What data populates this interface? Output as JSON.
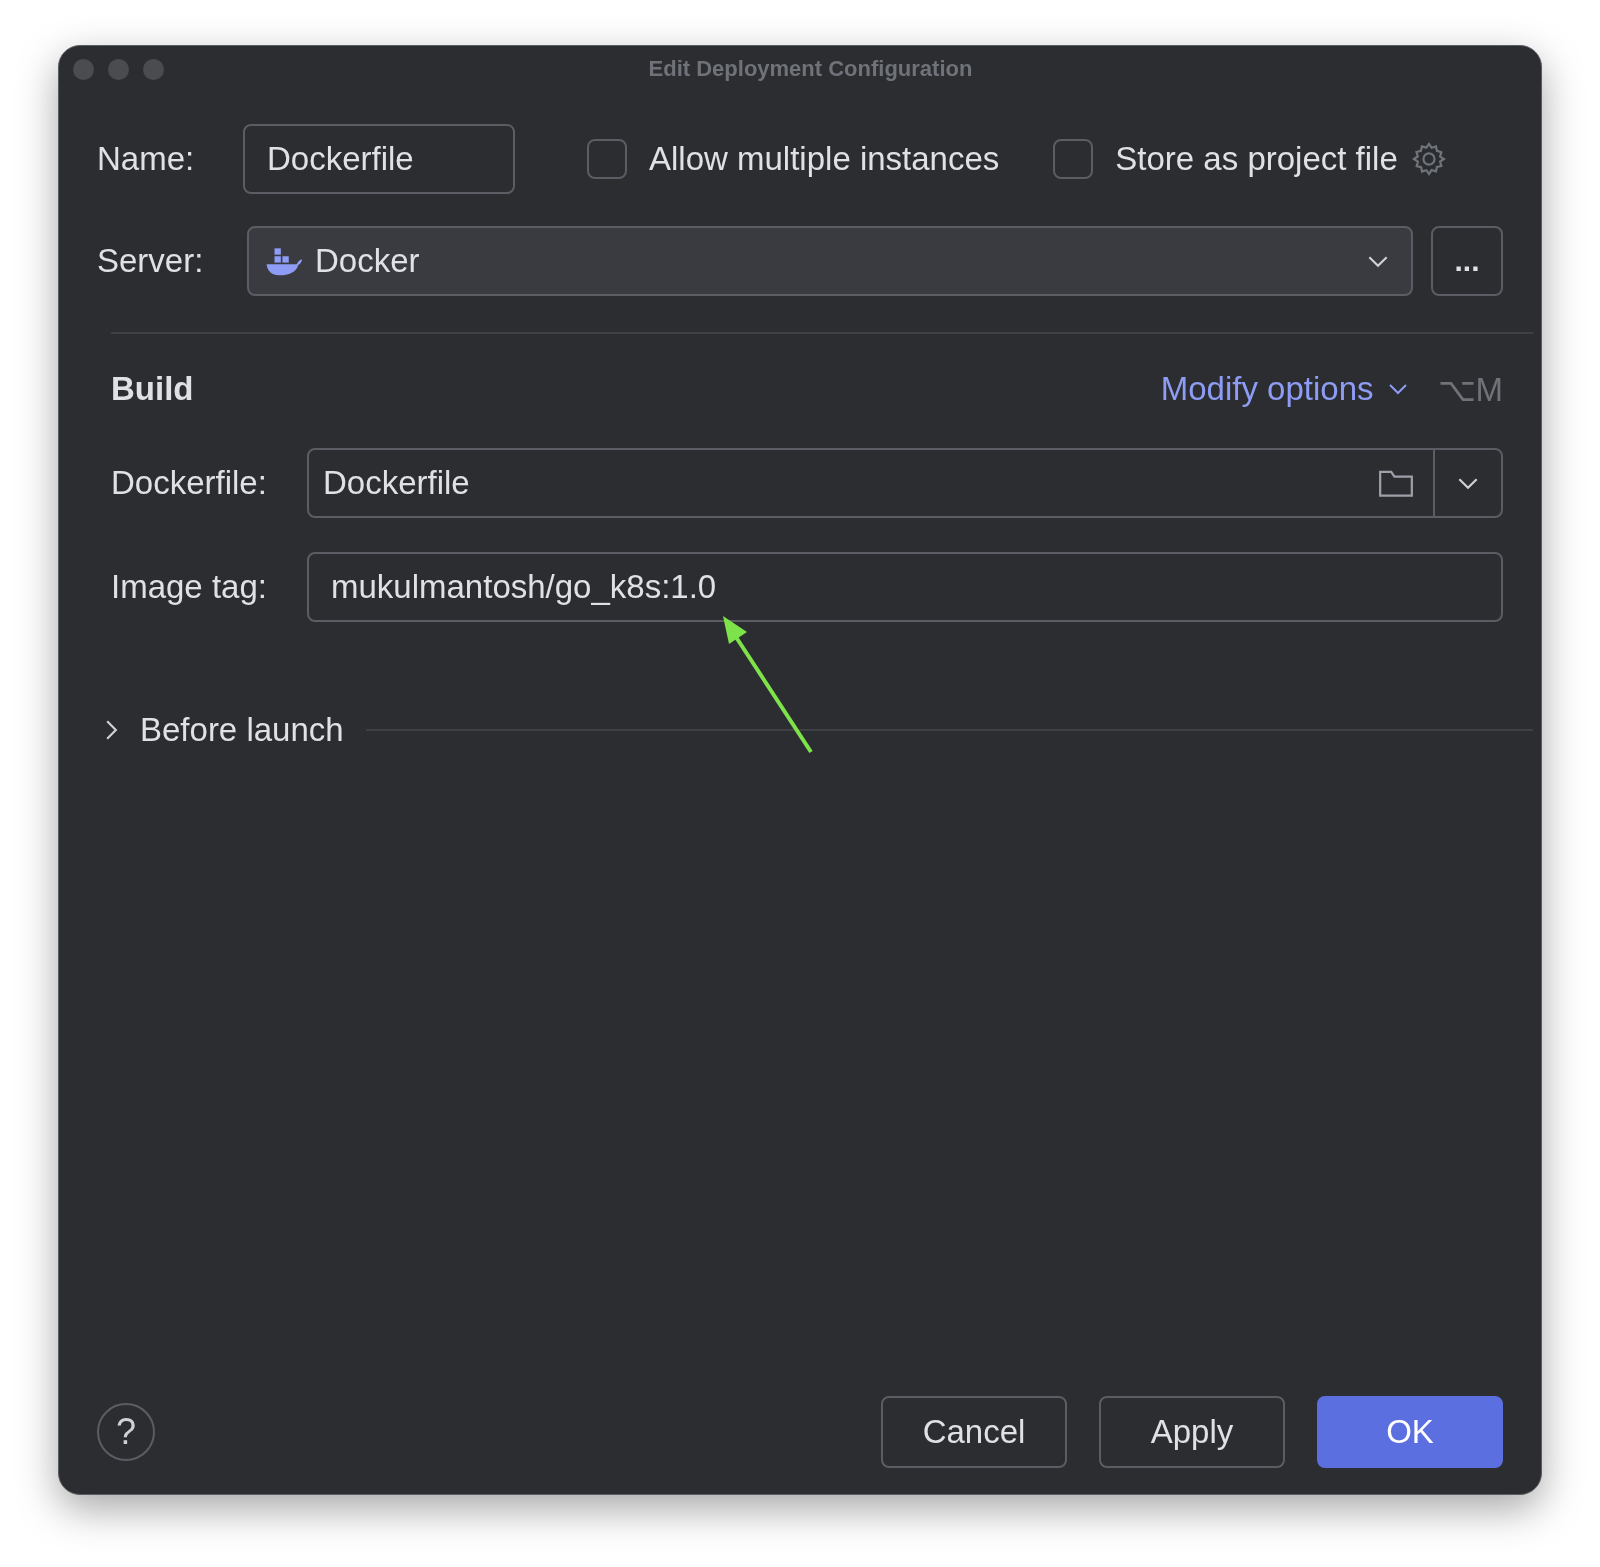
{
  "window": {
    "title": "Edit Deployment Configuration"
  },
  "name_field": {
    "label": "Name:",
    "value": "Dockerfile"
  },
  "options": [
    {
      "label": "Allow multiple instances",
      "checked": false
    },
    {
      "label": "Store as project file",
      "checked": false
    }
  ],
  "server": {
    "label": "Server:",
    "value": "Docker",
    "more": "..."
  },
  "build": {
    "heading": "Build",
    "modify_options": "Modify options",
    "shortcut": "⌥M",
    "fields": [
      {
        "kind": "dropdown",
        "label": "Dockerfile:",
        "value": "Dockerfile"
      },
      {
        "kind": "text",
        "label": "Image tag:",
        "value": "mukulmantosh/go_k8s:1.0"
      }
    ]
  },
  "before_launch": {
    "label": "Before launch",
    "expanded": false
  },
  "help": "?",
  "buttons": [
    {
      "label": "Cancel",
      "kind": "secondary"
    },
    {
      "label": "Apply",
      "kind": "secondary"
    },
    {
      "label": "OK",
      "kind": "primary"
    }
  ]
}
